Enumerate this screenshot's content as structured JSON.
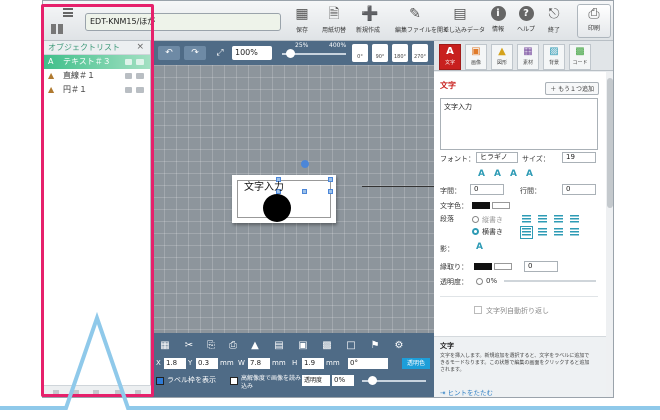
{
  "document_tab": "EDT-KNM15/ほが",
  "toolbar": [
    {
      "label": "保存",
      "icon": "save-icon"
    },
    {
      "label": "用紙切替",
      "icon": "paper-switch-icon"
    },
    {
      "label": "新規作成",
      "icon": "new-file-icon"
    },
    {
      "label": "編集ファイルを開く",
      "icon": "open-file-icon"
    },
    {
      "label": "差し込みデータ",
      "icon": "merge-data-icon"
    },
    {
      "label": "情報",
      "icon": "info-icon"
    },
    {
      "label": "ヘルプ",
      "icon": "help-icon"
    },
    {
      "label": "終了",
      "icon": "exit-icon"
    }
  ],
  "print_label": "印刷",
  "object_list": {
    "title": "オブジェクトリスト",
    "items": [
      {
        "label": "テキスト＃３",
        "selected": true
      },
      {
        "label": "直線＃１",
        "selected": false
      },
      {
        "label": "円＃１",
        "selected": false
      }
    ]
  },
  "canvas_toolbar": {
    "zoom": "100%",
    "zoom_min": "25%",
    "zoom_max": "400%",
    "rotations": [
      "0°",
      "90°",
      "180°",
      "270°"
    ]
  },
  "canvas": {
    "label_text": "文字入力"
  },
  "bottom_bar": {
    "x_label": "X",
    "x_value": "1.8",
    "y_label": "Y",
    "y_value": "0.3",
    "unit_mm": "mm",
    "w_label": "W",
    "w_value": "7.8",
    "h_label": "H",
    "h_value": "1.9",
    "angle": "0°",
    "transparency_color": "透明色",
    "show_frame": "ラベル枠を表示",
    "high_res": "高解像度で画像を読み込み",
    "opacity_label": "透明度",
    "opacity_value": "0%"
  },
  "right_tabs": [
    {
      "label": "文字",
      "icon": "A",
      "active": true
    },
    {
      "label": "画像",
      "icon": "▣",
      "active": false
    },
    {
      "label": "図形",
      "icon": "▲",
      "active": false
    },
    {
      "label": "素材",
      "icon": "▦",
      "active": false
    },
    {
      "label": "背景",
      "icon": "▨",
      "active": false
    },
    {
      "label": "コード",
      "icon": "▩",
      "active": false
    }
  ],
  "text_panel": {
    "title": "文字",
    "add_more": "＋ もう１つ追加",
    "text_value": "文字入力",
    "font_label": "フォント：",
    "font_value": "ヒラギノ",
    "size_label": "サイズ：",
    "size_value": "19",
    "char_spacing_label": "字間：",
    "char_spacing_value": "0",
    "line_spacing_label": "行間：",
    "line_spacing_value": "0",
    "color_label": "文字色：",
    "direction_label": "段落",
    "vertical": "縦書き",
    "horizontal": "横書き",
    "shadow_label": "影：",
    "outline_label": "縁取り：",
    "outline_value": "0",
    "opacity_label": "透明度：",
    "opacity_value": "0%",
    "wrap_label": "文字列自動折り返し"
  },
  "help": {
    "title": "文字",
    "body": "文字を挿入します。新規追加を選択すると、文字をラベルに追加できるモードなります。この状態で編集の画面をクリックすると追加されます。",
    "link": "ヒントをたたむ"
  },
  "colors": {
    "highlight": "#e6206b",
    "accent_red": "#c8201e",
    "panel_blue": "#4f6b86",
    "callout": "#8fc9ea"
  }
}
